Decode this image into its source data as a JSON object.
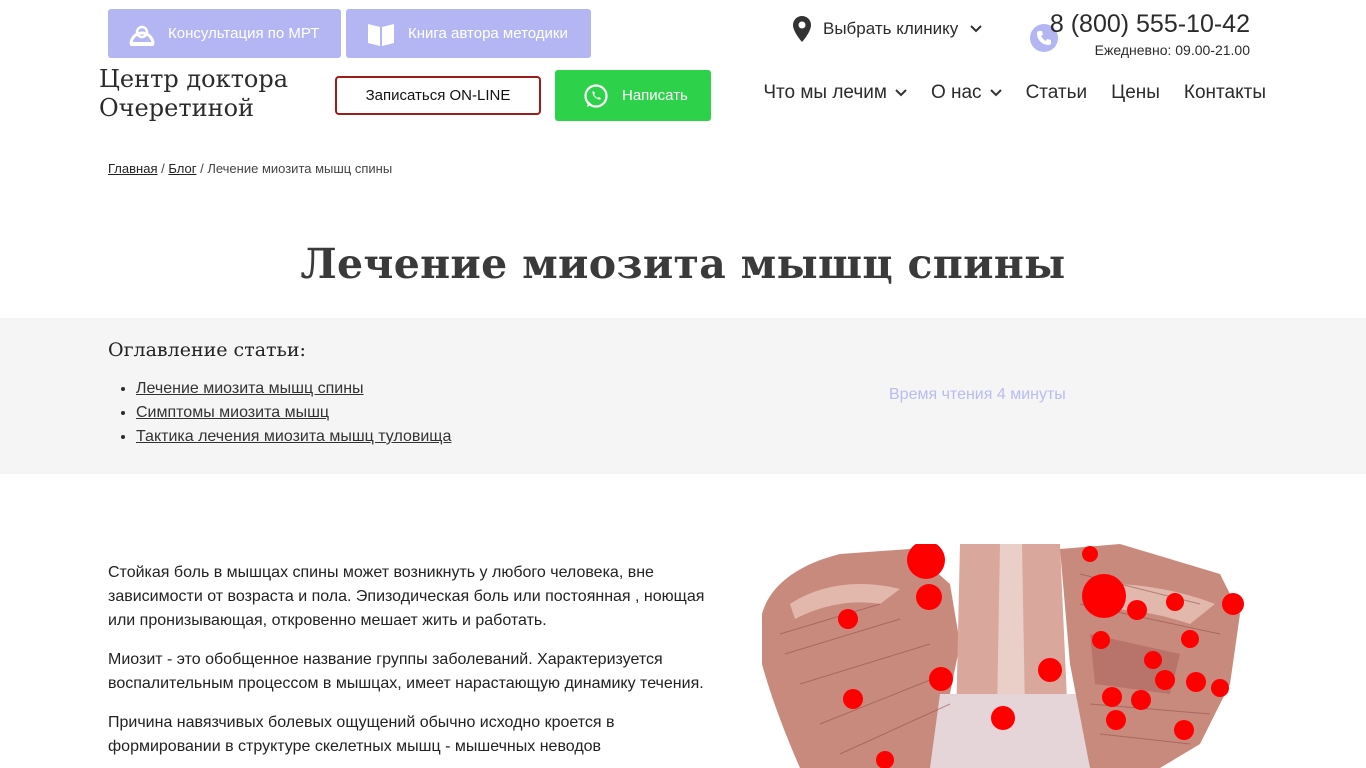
{
  "header": {
    "consult_button": "Консультация по МРТ",
    "book_button": "Книга автора методики",
    "clinic_select": "Выбрать клинику",
    "phone": "8 (800) 555-10-42",
    "hours": "Ежедневно: 09.00-21.00",
    "logo": "Центр доктора Очеретиной",
    "online_button": "Записаться ON-LINE",
    "write_button": "Написать",
    "nav": [
      "Что мы лечим",
      "О нас",
      "Статьи",
      "Цены",
      "Контакты"
    ]
  },
  "breadcrumb": {
    "home": "Главная",
    "sep1": "/",
    "blog": "Блог",
    "sep2": "/",
    "current": "Лечение миозита мышц спины"
  },
  "page": {
    "title": "Лечение миозита мышц спины"
  },
  "toc": {
    "title": "Оглавление статьи:",
    "items": [
      "Лечение миозита мышц спины",
      "Симптомы миозита мышц",
      "Тактика лечения миозита мышц туловища"
    ],
    "read_time": "Время чтения 4 минуты"
  },
  "article": {
    "paragraphs": [
      "Стойкая боль в мышцах спины может возникнуть у любого человека, вне зависимости от возраста и пола. Эпизодическая боль или постоянная , ноющая или пронизывающая, откровенно мешает жить и работать.",
      "Миозит - это обобщенное название группы заболеваний. Характеризуется воспалительным процессом в мышцах, имеет нарастающую динамику течения.",
      "Причина навязчивых болевых ощущений обычно исходно кроется в формировании в структуре скелетных мышц - мышечных неводов"
    ]
  },
  "colors": {
    "accent": "#b3b6f3",
    "whatsapp": "#2dd14a",
    "online_border": "#9c1c1c",
    "toc_bg": "#f5f5f5"
  }
}
